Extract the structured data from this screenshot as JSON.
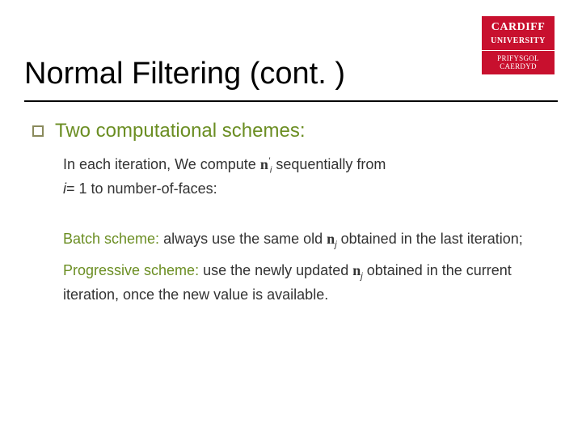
{
  "logo": {
    "top": "CARDIFF",
    "top2": "UNIVERSITY",
    "bot": "PRIFYSGOL",
    "bot2": "CAERDYD"
  },
  "title": "Normal Filtering (cont. )",
  "section_label": "Two computational schemes:",
  "p1a": "In each iteration,  We compute  ",
  "p1_sym_n": "n",
  "p1_sym_prime": "′",
  "p1_sym_i": "i",
  "p1b": " sequentially from",
  "p1c_i": "i",
  "p1c": "= 1 to number-of-faces:",
  "batch_label": "Batch scheme:",
  "batch_text_a": "  always use the same old ",
  "batch_sym_n": "n",
  "batch_sym_j": "j",
  "batch_text_b": " obtained in the last iteration;",
  "prog_label": "Progressive scheme:",
  "prog_text_a": " use the newly updated  ",
  "prog_sym_n": "n",
  "prog_sym_j": "j",
  "prog_text_b": " obtained in the current iteration, once the new value is available."
}
